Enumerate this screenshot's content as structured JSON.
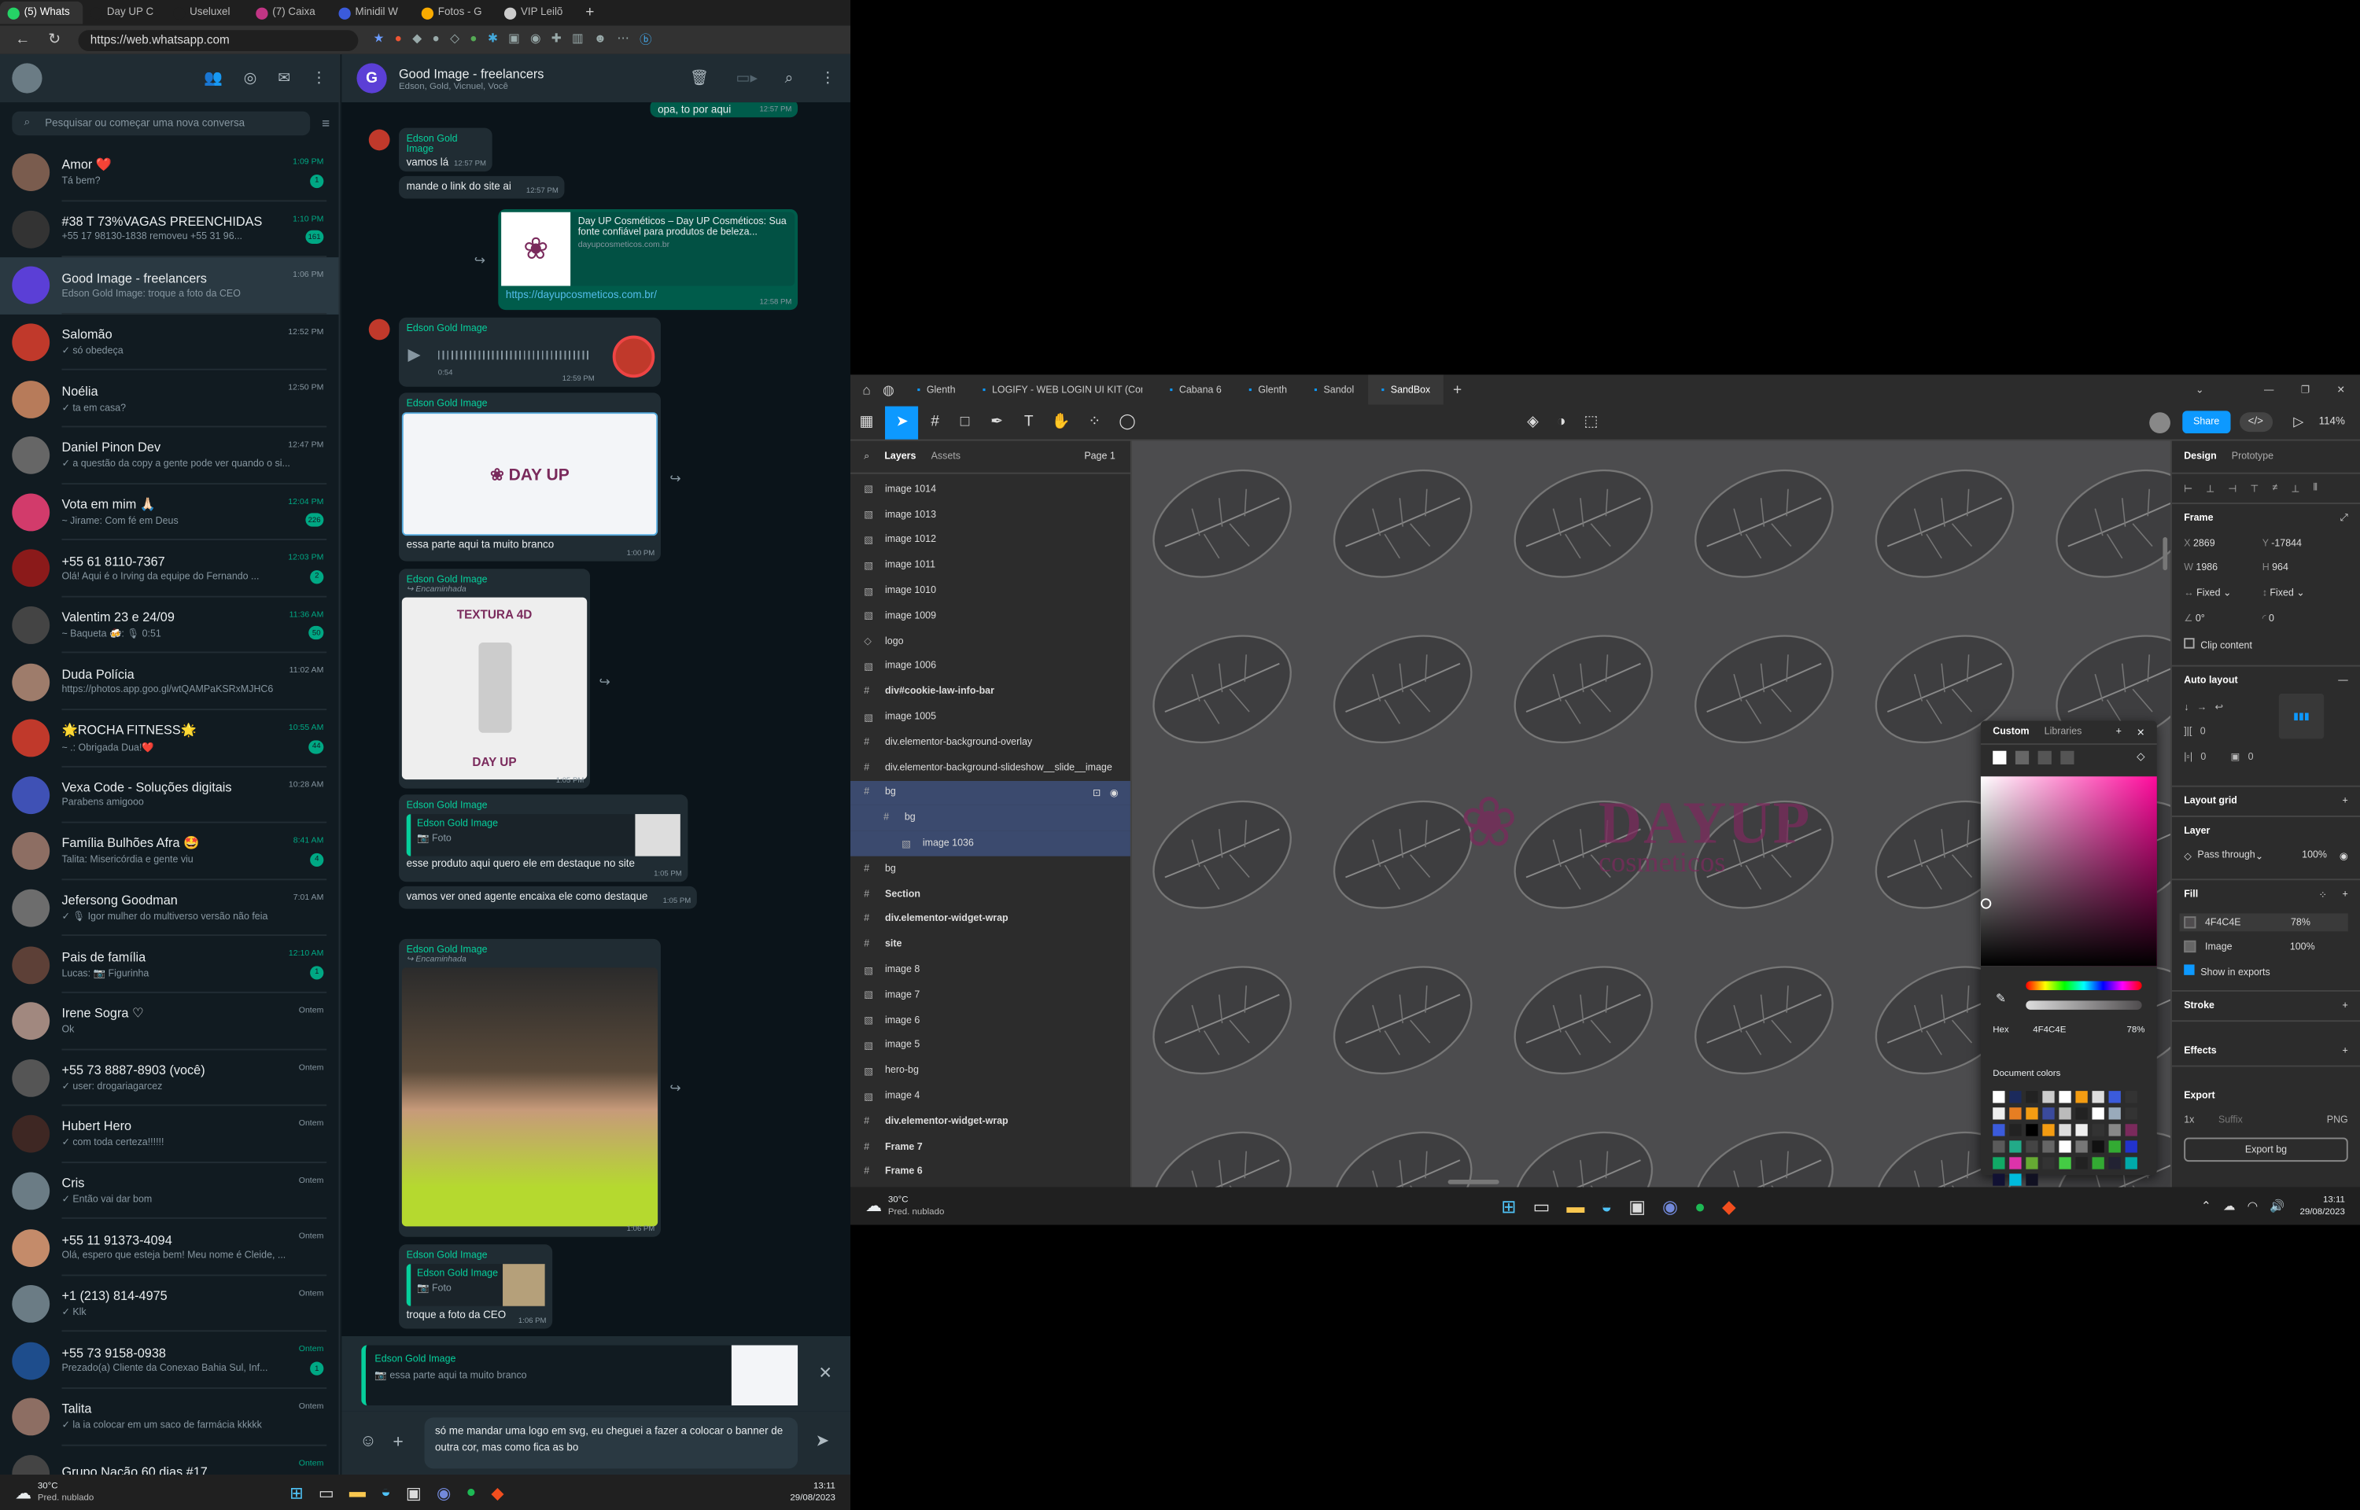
{
  "browser": {
    "tabs": [
      {
        "label": "(5) Whats",
        "color": "#25d366",
        "active": true
      },
      {
        "label": "Day UP C",
        "color": "#1f1f1f"
      },
      {
        "label": "Useluxel",
        "color": "#1f1f1f"
      },
      {
        "label": "(7) Caixa",
        "color": "#c13584"
      },
      {
        "label": "Minidil W",
        "color": "#3b5bdb"
      },
      {
        "label": "Fotos - G",
        "color": "#f9ab00"
      },
      {
        "label": "VIP Leilõ",
        "color": "#ccc"
      }
    ],
    "url": "https://web.whatsapp.com"
  },
  "whatsapp": {
    "search_placeholder": "Pesquisar ou começar uma nova conversa",
    "chats": [
      {
        "name": "Amor ❤️",
        "last": "Tá bem?",
        "time": "1:09 PM",
        "badge": "1",
        "green": true,
        "color": "#7a5c4e"
      },
      {
        "name": "#38 T 73%VAGAS PREENCHIDAS",
        "last": "+55 17 98130-1838 removeu +55 31 96...",
        "time": "1:10 PM",
        "badge": "161",
        "green": true,
        "color": "#333"
      },
      {
        "name": "Good Image - freelancers",
        "last": "Edson Gold Image: troque a foto da CEO",
        "time": "1:06 PM",
        "badge": "",
        "green": false,
        "color": "#5b3fd6",
        "selected": true
      },
      {
        "name": "Salomão",
        "last": "✓ só obedeça",
        "time": "12:52 PM",
        "badge": "",
        "green": false,
        "color": "#c0392b"
      },
      {
        "name": "Noélia",
        "last": "✓ ta em casa?",
        "time": "12:50 PM",
        "badge": "",
        "green": false,
        "color": "#b77b5a"
      },
      {
        "name": "Daniel Pinon Dev",
        "last": "✓ a questão da copy a gente pode ver quando o si...",
        "time": "12:47 PM",
        "badge": "",
        "green": false,
        "color": "#666"
      },
      {
        "name": "Vota em mim 🙏🏻",
        "last": "~ Jirame: Com fé em Deus",
        "time": "12:04 PM",
        "badge": "226",
        "green": true,
        "color": "#d23b6b"
      },
      {
        "name": "+55 61 8110-7367",
        "last": "Olá! Aqui é o Irving da equipe do Fernando ...",
        "time": "12:03 PM",
        "badge": "2",
        "green": true,
        "color": "#8b1a1a"
      },
      {
        "name": "Valentim 23 e 24/09",
        "last": "~ Baqueta 🍻: 🎙 0:51",
        "time": "11:36 AM",
        "badge": "50",
        "green": true,
        "color": "#444"
      },
      {
        "name": "Duda Polícia",
        "last": "https://photos.app.goo.gl/wtQAMPaKSRxMJHC6",
        "time": "11:02 AM",
        "badge": "",
        "green": false,
        "color": "#9e7c6b"
      },
      {
        "name": "🌟ROCHA FITNESS🌟",
        "last": "~ .: Obrigada Dua!❤️",
        "time": "10:55 AM",
        "badge": "44",
        "green": true,
        "color": "#c0392b"
      },
      {
        "name": "Vexa Code - Soluções digitais",
        "last": "Parabens amigooo",
        "time": "10:28 AM",
        "badge": "",
        "green": false,
        "color": "#3f51b5"
      },
      {
        "name": "Família Bulhões Afra 🤩",
        "last": "Talita: Misericórdia e gente viu",
        "time": "8:41 AM",
        "badge": "4",
        "green": true,
        "color": "#8d6e63"
      },
      {
        "name": "Jefersong Goodman",
        "last": "✓ 🎙 Igor mulher do multiverso versão não feia",
        "time": "7:01 AM",
        "badge": "",
        "green": false,
        "color": "#6d6d6d"
      },
      {
        "name": "Pais de família",
        "last": "Lucas: 📷 Figurinha",
        "time": "12:10 AM",
        "badge": "1",
        "green": true,
        "color": "#5d4037"
      },
      {
        "name": "Irene Sogra ♡",
        "last": "Ok",
        "time": "Ontem",
        "badge": "",
        "green": false,
        "color": "#a1887f"
      },
      {
        "name": "+55 73 8887-8903 (você)",
        "last": "✓ user: drogariagarcez",
        "time": "Ontem",
        "badge": "",
        "green": false,
        "color": "#555"
      },
      {
        "name": "Hubert Hero",
        "last": "✓ com toda certeza!!!!!!",
        "time": "Ontem",
        "badge": "",
        "green": false,
        "color": "#3e2723"
      },
      {
        "name": "Cris",
        "last": "✓ Então vai dar bom",
        "time": "Ontem",
        "badge": "",
        "green": false,
        "color": "#6b7c85"
      },
      {
        "name": "+55 11 91373-4094",
        "last": "Olá, espero que esteja bem! Meu nome é Cleide, ...",
        "time": "Ontem",
        "badge": "",
        "green": false,
        "color": "#c48b6a"
      },
      {
        "name": "+1 (213) 814-4975",
        "last": "✓ Klk",
        "time": "Ontem",
        "badge": "",
        "green": false,
        "color": "#6b7c85"
      },
      {
        "name": "+55 73 9158-0938",
        "last": "Prezado(a) Cliente da Conexao Bahia Sul, Inf...",
        "time": "Ontem",
        "badge": "1",
        "green": true,
        "color": "#1e4d8c"
      },
      {
        "name": "Talita",
        "last": "✓ la ia colocar em um saco de farmácia kkkkk",
        "time": "Ontem",
        "badge": "",
        "green": false,
        "color": "#8d6e63"
      },
      {
        "name": "Grupo Nação 60 dias #17",
        "last": "",
        "time": "Ontem",
        "badge": "",
        "green": true,
        "color": "#444"
      }
    ],
    "conv": {
      "title": "Good Image - freelancers",
      "subtitle": "Edson, Gold, Vicnuel, Você",
      "msg_top_out": "opa, to por aqui",
      "msg_top_out_time": "12:57 PM",
      "sender": "Edson Gold Image",
      "m1": "vamos lá",
      "m1_time": "12:57 PM",
      "m2": "mande o link do site ai",
      "m2_time": "12:57 PM",
      "link_title": "Day UP Cosméticos – Day UP Cosméticos: Sua fonte confiável para produtos de beleza...",
      "link_domain": "dayupcosmeticos.com.br",
      "link_url": "https://dayupcosmeticos.com.br/",
      "link_time": "12:58 PM",
      "audio_len": "0:54",
      "audio_time": "12:59 PM",
      "img1_caption": "essa parte aqui ta muito branco",
      "img1_time": "1:00 PM",
      "forwarded": "Encaminhada",
      "img2_time": "1:05 PM",
      "reply_label": "Foto",
      "m_destaque": "esse produto aqui quero ele em destaque no site",
      "m_destaque_time": "1:05 PM",
      "m_oned": "vamos ver oned agente encaixa ele como destaque",
      "m_oned_time": "1:05 PM",
      "img3_time": "1:06 PM",
      "m_ceo": "troque a foto da CEO",
      "m_ceo_time": "1:06 PM",
      "reply_quote_name": "Edson Gold Image",
      "reply_quote_text": "essa parte aqui ta muito branco",
      "compose_text": "só me mandar uma logo em svg, eu cheguei a fazer a colocar o banner de outra cor, mas como fica as bo"
    }
  },
  "taskbar": {
    "weather_temp": "30°C",
    "weather_desc": "Pred. nublado",
    "time": "13:11",
    "date": "29/08/2023"
  },
  "figma": {
    "tabs": [
      "Glenth",
      "LOGIFY - WEB LOGIN UI KIT (Comm",
      "Cabana 6",
      "Glenth",
      "Sandol",
      "SandBox"
    ],
    "share": "Share",
    "zoom": "114%",
    "layers_tab": "Layers",
    "assets_tab": "Assets",
    "page": "Page 1",
    "layers": [
      {
        "name": "image 1014",
        "level": 0
      },
      {
        "name": "image 1013",
        "level": 0
      },
      {
        "name": "image 1012",
        "level": 0
      },
      {
        "name": "image 1011",
        "level": 0
      },
      {
        "name": "image 1010",
        "level": 0
      },
      {
        "name": "image 1009",
        "level": 0
      },
      {
        "name": "logo",
        "level": 0
      },
      {
        "name": "image 1006",
        "level": 0
      },
      {
        "name": "div#cookie-law-info-bar",
        "level": 0
      },
      {
        "name": "image 1005",
        "level": 0
      },
      {
        "name": "div.elementor-background-overlay",
        "level": 0
      },
      {
        "name": "div.elementor-background-slideshow__slide__image",
        "level": 0
      },
      {
        "name": "bg",
        "level": 0,
        "selected": true
      },
      {
        "name": "bg",
        "level": 1,
        "selected": true
      },
      {
        "name": "image 1036",
        "level": 2,
        "selected": true
      },
      {
        "name": "bg",
        "level": 0
      },
      {
        "name": "Section",
        "level": 0
      },
      {
        "name": "div.elementor-widget-wrap",
        "level": 0
      },
      {
        "name": "site",
        "level": 0
      },
      {
        "name": "image 8",
        "level": 0
      },
      {
        "name": "image 7",
        "level": 0
      },
      {
        "name": "image 6",
        "level": 0
      },
      {
        "name": "image 5",
        "level": 0
      },
      {
        "name": "hero-bg",
        "level": 0
      },
      {
        "name": "image 4",
        "level": 0
      },
      {
        "name": "div.elementor-widget-wrap",
        "level": 0
      },
      {
        "name": "Frame 7",
        "level": 0
      },
      {
        "name": "Frame 6",
        "level": 0
      }
    ],
    "canvas_logo": "DAYUP",
    "canvas_logo_sub": "cosmeticos",
    "design_tab": "Design",
    "prototype_tab": "Prototype",
    "frame_label": "Frame",
    "x": "2869",
    "y": "-17844",
    "w": "1986",
    "h": "964",
    "fixed_w": "Fixed",
    "fixed_h": "Fixed",
    "rotation": "0°",
    "radius": "0",
    "clip": "Clip content",
    "auto_layout": "Auto layout",
    "layout_grid": "Layout grid",
    "layer_label": "Layer",
    "blend": "Pass through",
    "opacity": "100%",
    "fill_label": "Fill",
    "fill_hex": "4F4C4E",
    "fill_opacity": "78%",
    "fill_image": "Image",
    "fill_image_opacity": "100%",
    "show_exports": "Show in exports",
    "stroke": "Stroke",
    "effects": "Effects",
    "export": "Export",
    "export_scale": "1x",
    "export_suffix": "Suffix",
    "export_format": "PNG",
    "export_button": "Export bg",
    "picker": {
      "custom": "Custom",
      "libraries": "Libraries",
      "hex_label": "Hex",
      "hex": "4F4C4E",
      "opacity": "78%",
      "doc_colors": "Document colors"
    }
  }
}
